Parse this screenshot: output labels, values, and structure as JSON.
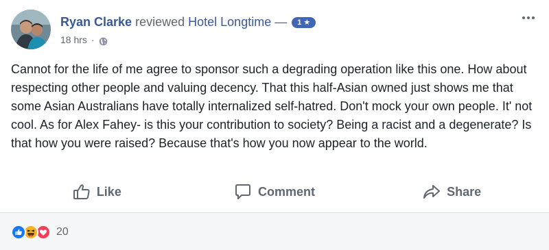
{
  "post": {
    "author": "Ryan Clarke",
    "verb": "reviewed",
    "page": "Hotel Longtime",
    "dash": "—",
    "rating": "1 ★",
    "time": "18 hrs",
    "separator": "·",
    "privacy_icon": "globe-icon",
    "menu_icon": "more-options-icon",
    "body": "Cannot for the life of me agree to sponsor such a degrading operation like this one. How about respecting other people and valuing decency. That this half-Asian owned just shows me that some Asian Australians have totally internalized self-hatred. Don't mock your own people. It' not cool. As for Alex Fahey- is this your contribution to society? Being a racist and a degenerate? Is that how you were raised? Because that's how you now appear to the world."
  },
  "actions": {
    "like": {
      "label": "Like",
      "icon": "thumbs-up-icon"
    },
    "comment": {
      "label": "Comment",
      "icon": "comment-icon"
    },
    "share": {
      "label": "Share",
      "icon": "share-icon"
    }
  },
  "reactions": {
    "icons": [
      "like-reaction-icon",
      "haha-reaction-icon",
      "love-reaction-icon"
    ],
    "count": "20"
  },
  "colors": {
    "link": "#385898",
    "muted": "#616770",
    "badge": "#4267b2",
    "like": "#1877f2",
    "haha": "#f7b125",
    "love": "#f33e58"
  }
}
